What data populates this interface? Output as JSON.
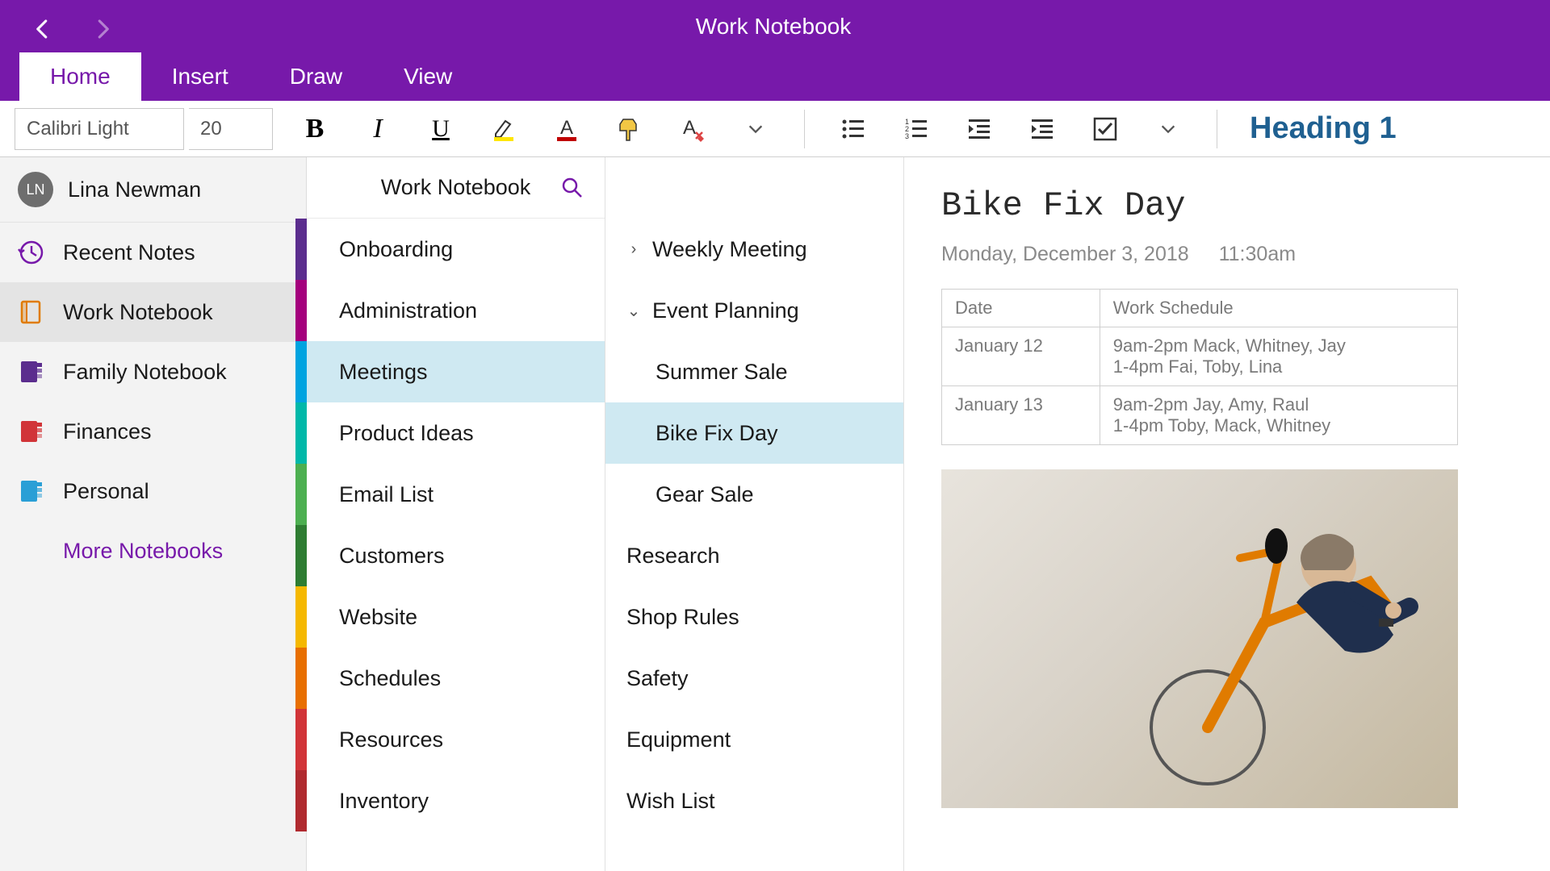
{
  "window": {
    "title": "Work Notebook"
  },
  "ribbon": {
    "tabs": [
      "Home",
      "Insert",
      "Draw",
      "View"
    ],
    "active_tab": "Home",
    "font_name": "Calibri Light",
    "font_size": "20",
    "style_label": "Heading 1"
  },
  "user": {
    "initials": "LN",
    "name": "Lina Newman"
  },
  "nav": {
    "items": [
      {
        "id": "recent",
        "label": "Recent Notes",
        "icon": "history",
        "color": "#7719aa"
      },
      {
        "id": "work",
        "label": "Work Notebook",
        "icon": "notebook",
        "color": "#e07b00",
        "selected": true
      },
      {
        "id": "family",
        "label": "Family Notebook",
        "icon": "notebook-tabs",
        "color": "#5b2d8e"
      },
      {
        "id": "finances",
        "label": "Finances",
        "icon": "notebook-tabs",
        "color": "#d13438"
      },
      {
        "id": "personal",
        "label": "Personal",
        "icon": "notebook-tabs",
        "color": "#2a9fd6"
      }
    ],
    "more_label": "More Notebooks"
  },
  "sections": {
    "header": "Work Notebook",
    "items": [
      {
        "label": "Onboarding",
        "color": "#5b2d8e"
      },
      {
        "label": "Administration",
        "color": "#a4007d"
      },
      {
        "label": "Meetings",
        "color": "#00a3e0",
        "selected": true
      },
      {
        "label": "Product Ideas",
        "color": "#00b8a9"
      },
      {
        "label": "Email List",
        "color": "#4caf50"
      },
      {
        "label": "Customers",
        "color": "#2e7d32"
      },
      {
        "label": "Website",
        "color": "#f5b800"
      },
      {
        "label": "Schedules",
        "color": "#e86f00"
      },
      {
        "label": "Resources",
        "color": "#d13438"
      },
      {
        "label": "Inventory",
        "color": "#b02a2f"
      }
    ]
  },
  "pages": {
    "items": [
      {
        "label": "Weekly Meeting",
        "expand": "right"
      },
      {
        "label": "Event Planning",
        "expand": "down"
      },
      {
        "label": "Summer Sale",
        "child": true
      },
      {
        "label": "Bike Fix Day",
        "child": true,
        "selected": true
      },
      {
        "label": "Gear Sale",
        "child": true
      },
      {
        "label": "Research"
      },
      {
        "label": "Shop Rules"
      },
      {
        "label": "Safety"
      },
      {
        "label": "Equipment"
      },
      {
        "label": "Wish List"
      }
    ]
  },
  "note": {
    "title": "Bike Fix Day",
    "date": "Monday, December 3, 2018",
    "time": "11:30am",
    "table": {
      "headers": [
        "Date",
        "Work Schedule"
      ],
      "rows": [
        [
          "January 12",
          "9am-2pm Mack, Whitney, Jay\n1-4pm Fai, Toby, Lina"
        ],
        [
          "January 13",
          "9am-2pm Jay, Amy, Raul\n1-4pm Toby, Mack, Whitney"
        ]
      ]
    }
  }
}
